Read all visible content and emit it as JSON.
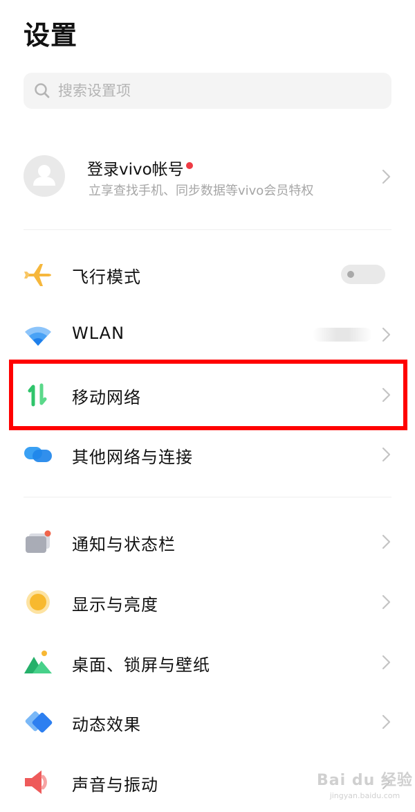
{
  "header": {
    "title": "设置"
  },
  "search": {
    "placeholder": "搜索设置项"
  },
  "account": {
    "name": "登录vivo帐号",
    "subtitle": "立享查找手机、同步数据等vivo会员特权"
  },
  "settings_group_1": [
    {
      "label": "飞行模式",
      "icon": "airplane-icon",
      "control": "toggle",
      "toggle_on": false
    },
    {
      "label": "WLAN",
      "icon": "wifi-icon",
      "control": "chevron"
    },
    {
      "label": "移动网络",
      "icon": "mobile-network-icon",
      "control": "chevron",
      "highlighted": true
    },
    {
      "label": "其他网络与连接",
      "icon": "connections-icon",
      "control": "chevron"
    }
  ],
  "settings_group_2": [
    {
      "label": "通知与状态栏",
      "icon": "notification-icon"
    },
    {
      "label": "显示与亮度",
      "icon": "brightness-icon"
    },
    {
      "label": "桌面、锁屏与壁纸",
      "icon": "wallpaper-icon"
    },
    {
      "label": "动态效果",
      "icon": "animation-icon"
    },
    {
      "label": "声音与振动",
      "icon": "sound-icon"
    }
  ],
  "colors": {
    "highlight_border": "#ff0000",
    "notification_dot": "#ee3b44",
    "airplane": "#f6b73c",
    "wifi": "#2d8cf0",
    "mobile_network": "#2fc46b",
    "brightness": "#f8b92e"
  },
  "watermark": {
    "brand": "Bai du 经验",
    "url": "jingyan.baidu.com"
  }
}
